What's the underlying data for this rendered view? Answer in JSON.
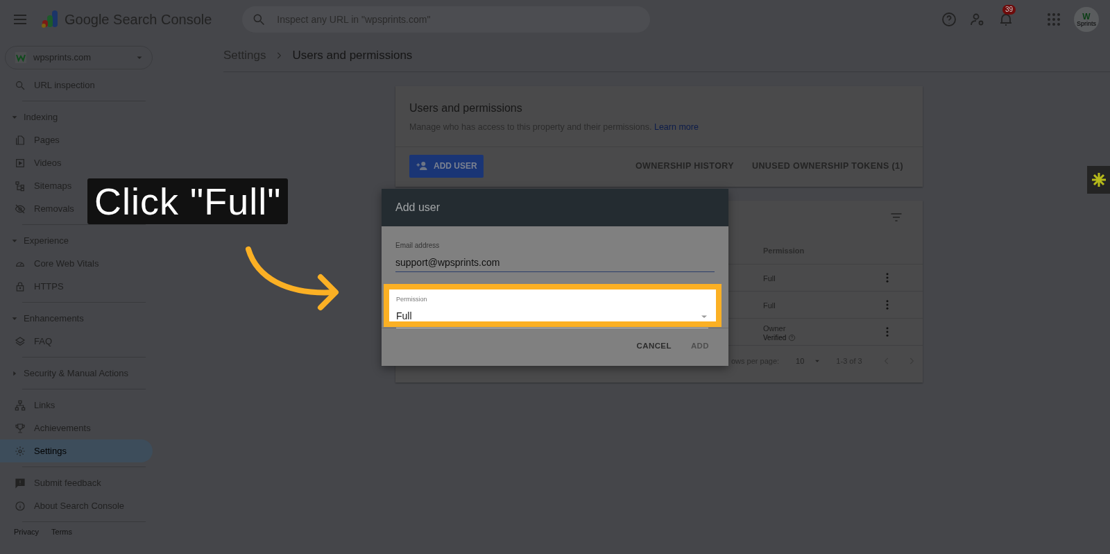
{
  "header": {
    "product_name": "Google Search Console",
    "search": {
      "placeholder": "Inspect any URL in \"wpsprints.com\""
    },
    "notification_count": "39",
    "avatar": {
      "mark": "W",
      "label": "Sprints"
    }
  },
  "sidebar": {
    "property": "wpsprints.com",
    "sections": [
      {
        "items": [
          {
            "label": "URL inspection",
            "selected": false
          }
        ]
      },
      {
        "title": "Indexing",
        "expanded": true,
        "items": [
          {
            "label": "Pages",
            "selected": false
          },
          {
            "label": "Videos",
            "selected": false
          },
          {
            "label": "Sitemaps",
            "selected": false
          },
          {
            "label": "Removals",
            "selected": false
          }
        ]
      },
      {
        "title": "Experience",
        "expanded": true,
        "items": [
          {
            "label": "Core Web Vitals",
            "selected": false
          },
          {
            "label": "HTTPS",
            "selected": false
          }
        ]
      },
      {
        "title": "Enhancements",
        "expanded": true,
        "items": [
          {
            "label": "FAQ",
            "selected": false
          }
        ]
      },
      {
        "title": "Security & Manual Actions",
        "expanded": false
      },
      {
        "items": [
          {
            "label": "Links",
            "selected": false
          },
          {
            "label": "Achievements",
            "selected": false
          },
          {
            "label": "Settings",
            "selected": true
          }
        ]
      },
      {
        "items": [
          {
            "label": "Submit feedback",
            "selected": false
          },
          {
            "label": "About Search Console",
            "selected": false
          }
        ]
      }
    ],
    "footer_links": [
      "Privacy",
      "Terms"
    ]
  },
  "breadcrumb": [
    "Settings",
    "Users and permissions"
  ],
  "users_card": {
    "title": "Users and permissions",
    "description": "Manage who has access to this property and their permissions.",
    "link": "Learn more",
    "add_button": "ADD USER",
    "links": [
      "OWNERSHIP HISTORY",
      "UNUSED OWNERSHIP TOKENS (1)"
    ]
  },
  "table": {
    "column": "Permission",
    "rows": [
      {
        "permission": "Full"
      },
      {
        "permission": "Full"
      },
      {
        "permission": "Owner",
        "note": "Verified"
      }
    ],
    "footer": {
      "rows_per_page_label": "ows per page:",
      "rows_per_page": "10",
      "range": "1-3 of 3"
    }
  },
  "dialog": {
    "title": "Add user",
    "email_label": "Email address",
    "email_value": "support@wpsprints.com",
    "permission_label": "Permission",
    "permission_value": "Full",
    "buttons": [
      {
        "label": "CANCEL",
        "disabled": false
      },
      {
        "label": "ADD",
        "disabled": true
      }
    ]
  },
  "callout": {
    "text": "Click \"Full\""
  }
}
